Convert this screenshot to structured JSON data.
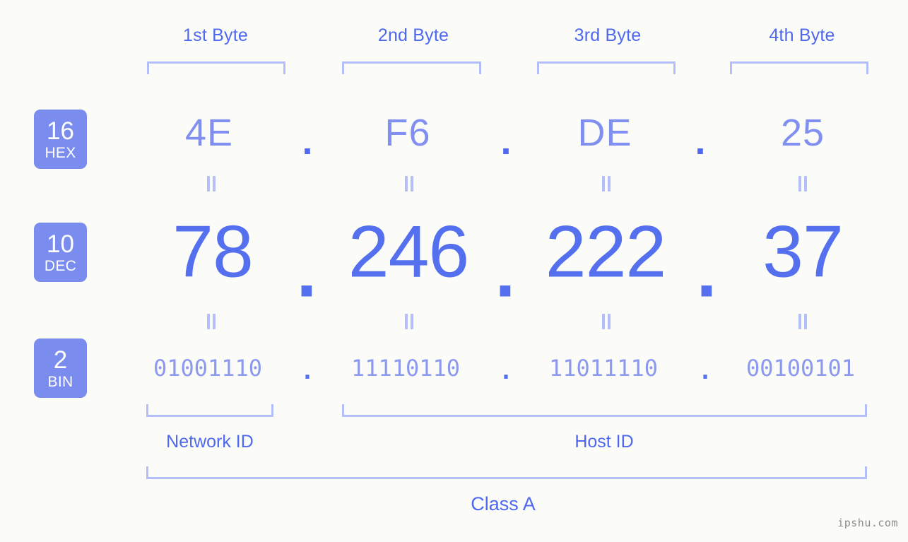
{
  "watermark": "ipshu.com",
  "colors": {
    "background": "#fbfcf8",
    "accent_strong": "#4f68ef",
    "accent_dec": "#5570ee",
    "accent_hex": "#808ff0",
    "accent_bin": "#8c99ee",
    "accent_pale": "#b4bef8",
    "badge": "#7b8cef",
    "badge_text": "#ffffff",
    "watermark_text": "#8a8a8a"
  },
  "byte_headers": [
    {
      "label": "1st Byte"
    },
    {
      "label": "2nd Byte"
    },
    {
      "label": "3rd Byte"
    },
    {
      "label": "4th Byte"
    }
  ],
  "bases": [
    {
      "id": "hex",
      "number": "16",
      "abbr": "HEX"
    },
    {
      "id": "dec",
      "number": "10",
      "abbr": "DEC"
    },
    {
      "id": "bin",
      "number": "2",
      "abbr": "BIN"
    }
  ],
  "separator": ".",
  "equals_symbol": "=",
  "rows": {
    "hex": {
      "values": [
        "4E",
        "F6",
        "DE",
        "25"
      ]
    },
    "dec": {
      "values": [
        "78",
        "246",
        "222",
        "37"
      ]
    },
    "bin": {
      "values": [
        "01001110",
        "11110110",
        "11011110",
        "00100101"
      ]
    }
  },
  "regions": [
    {
      "label": "Network ID"
    },
    {
      "label": "Host ID"
    }
  ],
  "class": {
    "label": "Class A"
  },
  "ip_address": {
    "hex": "4E.F6.DE.25",
    "dec": "78.246.222.37",
    "bin": "01001110.11110110.11011110.00100101"
  }
}
